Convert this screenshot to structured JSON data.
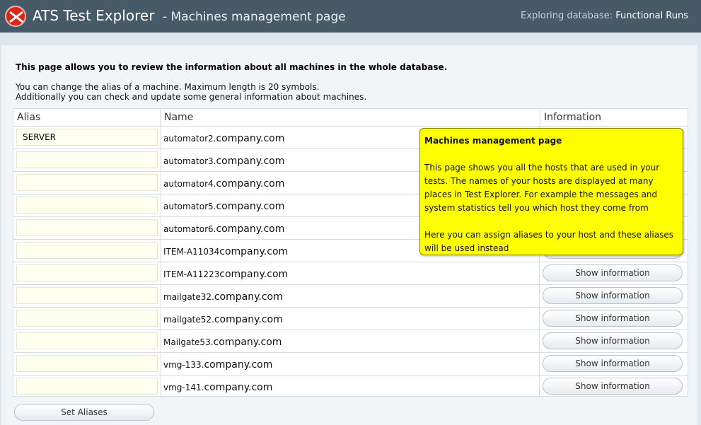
{
  "header": {
    "app_title": "ATS Test Explorer",
    "page_subtitle": "- Machines management page",
    "db_label": "Exploring database:",
    "db_name": "Functional Runs"
  },
  "intro": {
    "bold_line": "This page allows you to review the information about all machines in the whole database.",
    "line1": "You can change the alias of a machine. Maximum length is 20 symbols.",
    "line2": "Additionally you can check and update some general information about machines."
  },
  "table": {
    "headers": [
      "Alias",
      "Name",
      "Information"
    ],
    "rows": [
      {
        "alias": "SERVER",
        "prefix": "automator2.",
        "domain": "company.com"
      },
      {
        "alias": "",
        "prefix": "automator3.",
        "domain": "company.com"
      },
      {
        "alias": "",
        "prefix": "automator4.",
        "domain": "company.com"
      },
      {
        "alias": "",
        "prefix": "automator5.",
        "domain": "company.com"
      },
      {
        "alias": "",
        "prefix": "automator6.",
        "domain": "company.com"
      },
      {
        "alias": "",
        "prefix": "ITEM-A11034",
        "domain": "company.com"
      },
      {
        "alias": "",
        "prefix": "ITEM-A11223",
        "domain": "company.com"
      },
      {
        "alias": "",
        "prefix": "mailgate32.",
        "domain": "company.com"
      },
      {
        "alias": "",
        "prefix": "mailgate52.",
        "domain": "company.com"
      },
      {
        "alias": "",
        "prefix": "Mailgate53.",
        "domain": "company.com"
      },
      {
        "alias": "",
        "prefix": "vmg-133.",
        "domain": "company.com"
      },
      {
        "alias": "",
        "prefix": "vmg-141.",
        "domain": "company.com"
      }
    ],
    "show_info_label": "Show information"
  },
  "set_aliases_label": "Set Aliases",
  "tooltip": {
    "title": "Machines management page",
    "para1": "This page shows you all the hosts that are used in your tests. The names of your hosts are displayed at many places in Test Explorer. For example the messages and system statistics tell you which host they come from",
    "para2": "Here you can assign aliases to your host and these aliases will be used instead"
  }
}
